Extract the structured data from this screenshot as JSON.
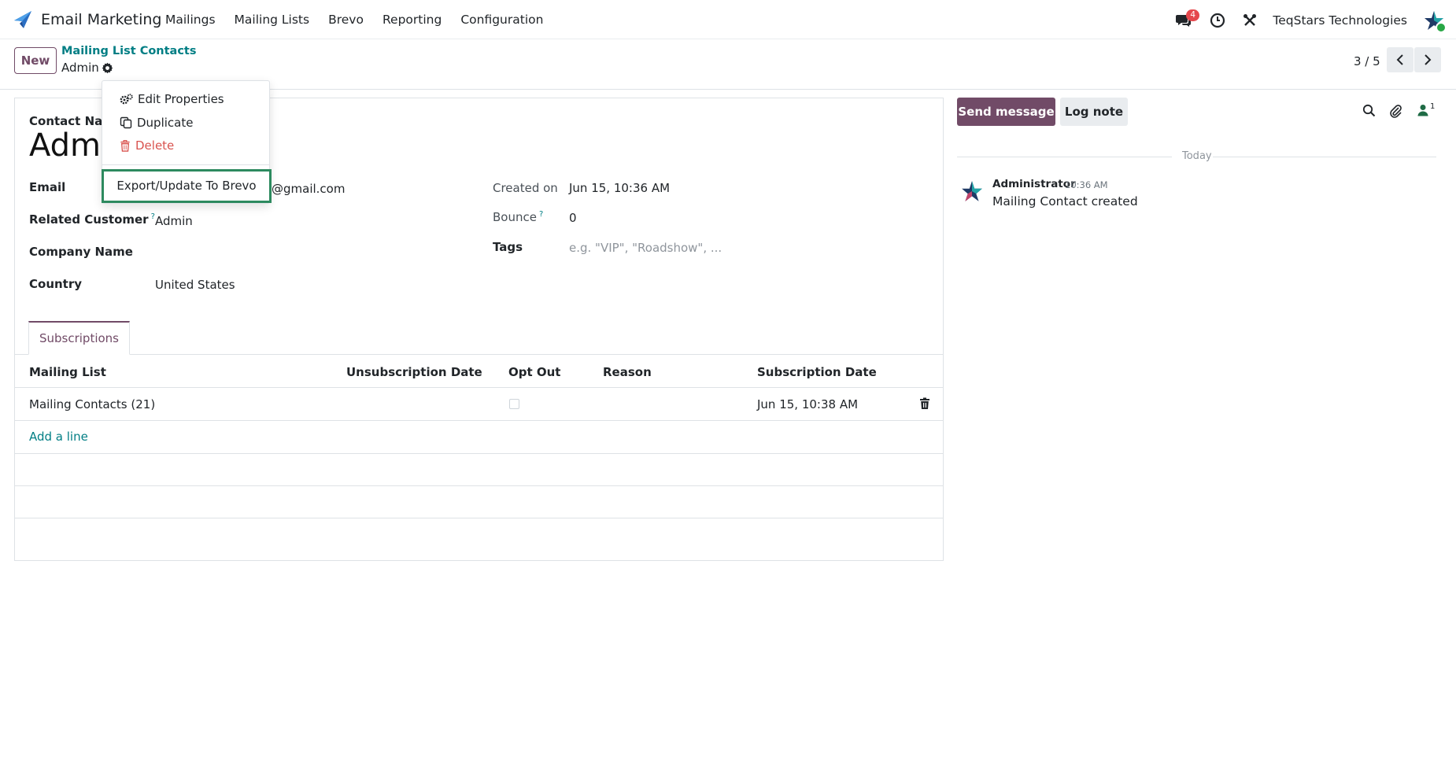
{
  "navbar": {
    "app_name": "Email Marketing",
    "menu": [
      "Mailings",
      "Mailing Lists",
      "Brevo",
      "Reporting",
      "Configuration"
    ],
    "messages_badge": "4",
    "company": "TeqStars Technologies",
    "icons": [
      "app-logo-icon",
      "chat-icon",
      "clock-icon",
      "tools-icon",
      "user-avatar-icon"
    ]
  },
  "control_panel": {
    "new_label": "New",
    "breadcrumb_parent": "Mailing List Contacts",
    "breadcrumb_current": "Admin",
    "pager": "3 / 5"
  },
  "action_menu": {
    "edit_properties": "Edit Properties",
    "duplicate": "Duplicate",
    "delete": "Delete",
    "export": "Export/Update To Brevo"
  },
  "form": {
    "contact_name_label": "Contact Name",
    "contact_name_value": "Admin",
    "email_label": "Email",
    "email_value_visible": "@gmail.com",
    "related_customer_label": "Related Customer",
    "related_customer_help": "?",
    "related_customer_value": "Admin",
    "company_name_label": "Company Name",
    "company_name_value": "",
    "country_label": "Country",
    "country_value": "United States",
    "created_on_label": "Created on",
    "created_on_value": "Jun 15, 10:36 AM",
    "bounce_label": "Bounce",
    "bounce_help": "?",
    "bounce_value": "0",
    "tags_label": "Tags",
    "tags_placeholder": "e.g. \"VIP\", \"Roadshow\", ..."
  },
  "tabs": [
    "Subscriptions"
  ],
  "subscriptions": {
    "columns": [
      "Mailing List",
      "Unsubscription Date",
      "Opt Out",
      "Reason",
      "Subscription Date"
    ],
    "rows": [
      {
        "mailing_list": "Mailing Contacts (21)",
        "unsubscription_date": "",
        "opt_out": false,
        "reason": "",
        "subscription_date": "Jun 15, 10:38 AM"
      }
    ],
    "add_line": "Add a line"
  },
  "chatter": {
    "send_message": "Send message",
    "log_note": "Log note",
    "followers_count": "1",
    "date_separator": "Today",
    "messages": [
      {
        "author": "Administrator",
        "time": "10:36 AM",
        "body": "Mailing Contact created"
      }
    ]
  },
  "colors": {
    "brand": "#714b67",
    "link": "#017e84",
    "danger": "#d9534f",
    "highlight_border": "#2d8a5f"
  }
}
